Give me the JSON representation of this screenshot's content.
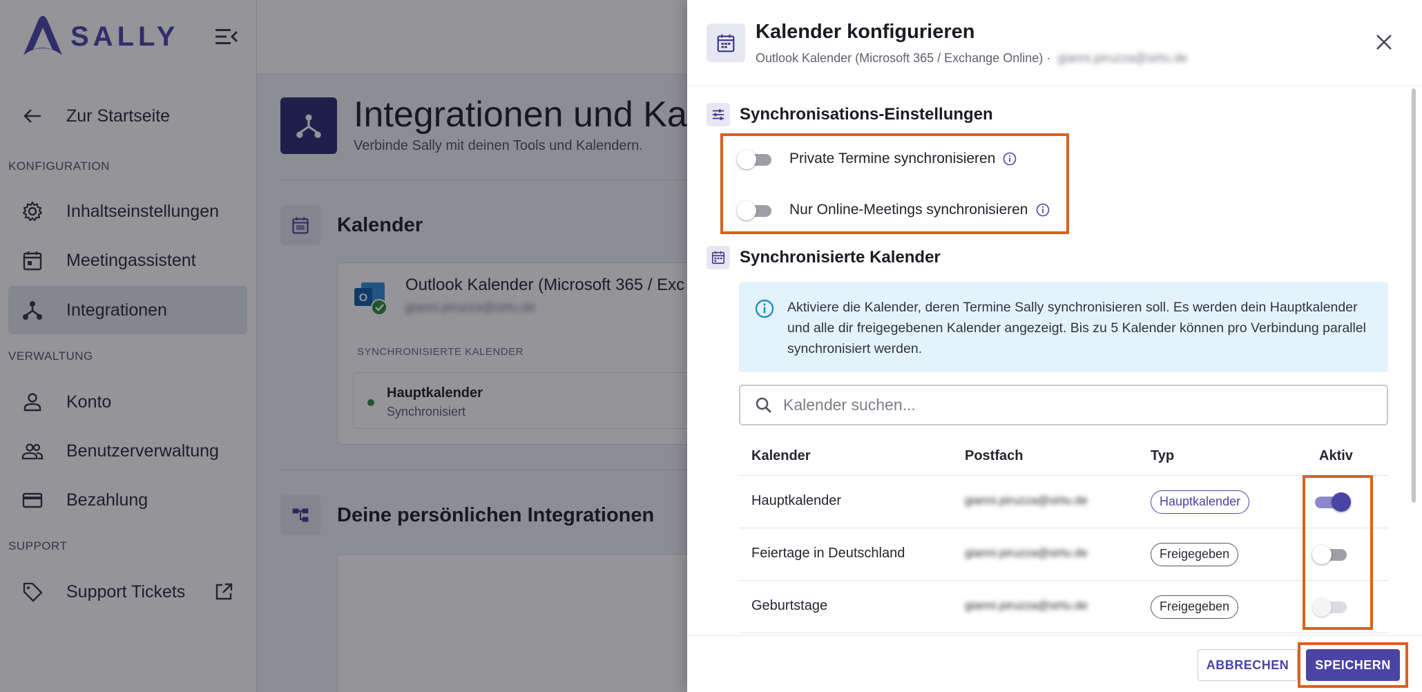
{
  "sidebar": {
    "logo_text": "SALLY",
    "back_label": "Zur Startseite",
    "sections": {
      "config": "KONFIGURATION",
      "admin": "VERWALTUNG",
      "support": "SUPPORT"
    },
    "items": {
      "content": "Inhaltseinstellungen",
      "meeting": "Meetingassistent",
      "integrations": "Integrationen",
      "account": "Konto",
      "users": "Benutzerverwaltung",
      "billing": "Bezahlung",
      "tickets": "Support Tickets"
    },
    "active_item": "integrations"
  },
  "main": {
    "title": "Integrationen und Kal",
    "subtitle": "Verbinde Sally mit deinen Tools und Kalendern.",
    "calendar_section_title": "Kalender",
    "provider_name": "Outlook Kalender (Microsoft 365 / Exc",
    "provider_email": "gianni.piruzza@sirtu.de",
    "synced_header": "SYNCHRONISIERTE KALENDER",
    "synced_calendar": {
      "name": "Hauptkalender",
      "status": "Synchronisiert"
    },
    "personal_section_title": "Deine persönlichen Integrationen"
  },
  "drawer": {
    "title": "Kalender konfigurieren",
    "subtitle": "Outlook Kalender (Microsoft 365 / Exchange Online) ·",
    "subtitle_email": "gianni.piruzza@sirtu.de",
    "sync_settings_title": "Synchronisations-Einstellungen",
    "toggles": {
      "private": {
        "label": "Private Termine synchronisieren",
        "on": false
      },
      "online": {
        "label": "Nur Online-Meetings synchronisieren",
        "on": false
      }
    },
    "synced_calendars_title": "Synchronisierte Kalender",
    "info_text": "Aktiviere die Kalender, deren Termine Sally synchronisieren soll. Es werden dein Hauptkalender und alle dir freigegebenen Kalender angezeigt. Bis zu 5 Kalender können pro Verbindung parallel synchronisiert werden.",
    "search_placeholder": "Kalender suchen...",
    "table": {
      "headers": {
        "calendar": "Kalender",
        "mailbox": "Postfach",
        "type": "Typ",
        "active": "Aktiv"
      },
      "rows": [
        {
          "calendar": "Hauptkalender",
          "mailbox": "gianni.piruzza@sirtu.de",
          "type": "Hauptkalender",
          "active": true
        },
        {
          "calendar": "Feiertage in Deutschland",
          "mailbox": "gianni.piruzza@sirtu.de",
          "type": "Freigegeben",
          "active": false
        },
        {
          "calendar": "Geburtstage",
          "mailbox": "gianni.piruzza@sirtu.de",
          "type": "Freigegeben",
          "active": false
        }
      ]
    },
    "cancel_label": "ABBRECHEN",
    "save_label": "SPEICHERN"
  },
  "colors": {
    "brand": "#4a44a4",
    "brand_dark": "#2c2b72",
    "highlight": "#d9611f",
    "info_bg": "#e4f3fb",
    "success": "#2e8b3e"
  }
}
